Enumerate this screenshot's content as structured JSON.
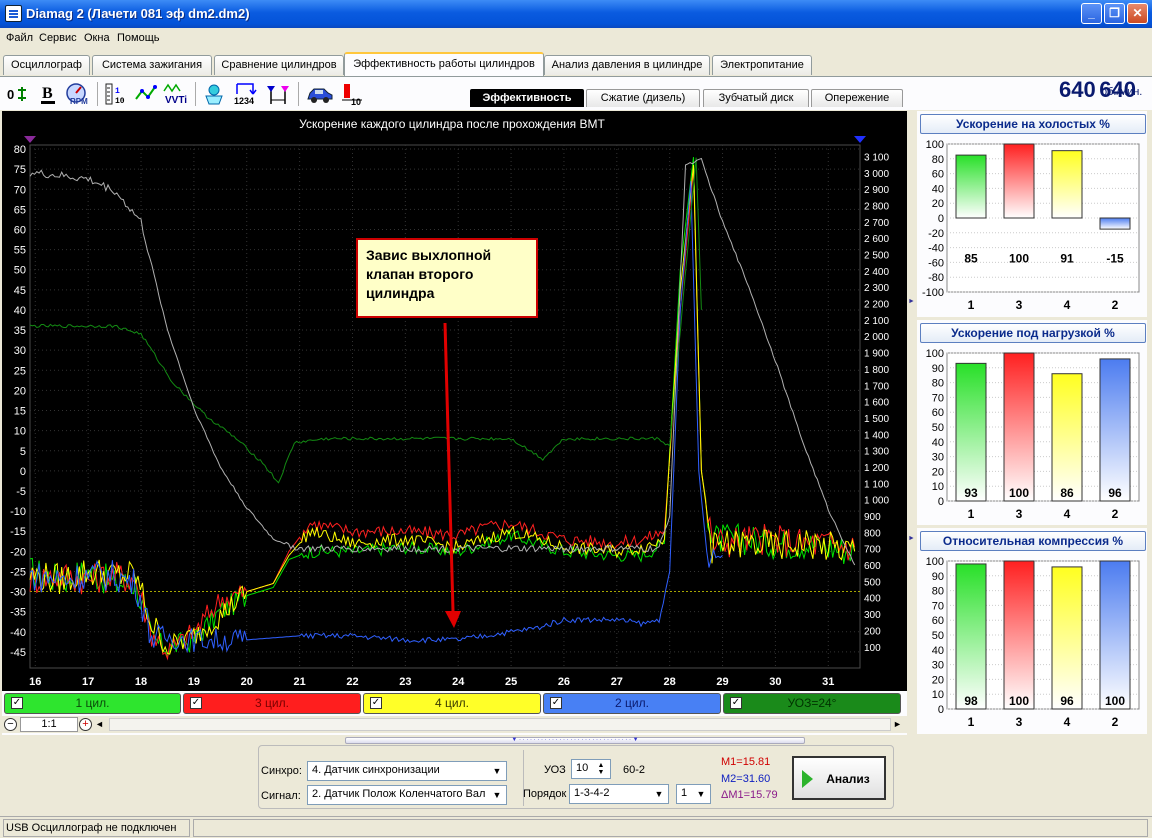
{
  "window": {
    "title": "Diamag 2 (Лачети 081 эф dm2.dm2)"
  },
  "menu": [
    "Файл",
    "Сервис",
    "Окна",
    "Помощь"
  ],
  "tabs": [
    "Осциллограф",
    "Система зажигания",
    "Сравнение цилиндров",
    "Эффективность работы цилиндров",
    "Анализ давления в цилиндре",
    "Электропитание"
  ],
  "active_tab": 3,
  "toolbar": {
    "icons": [
      "zero-icon",
      "bold-b-icon",
      "rpm-icon",
      "ruler-icon",
      "points-icon",
      "vvti-icon",
      "cylinder-icon",
      "numbers-1234-icon",
      "marker-icon",
      "car-icon",
      "bar-10-icon"
    ]
  },
  "subtabs": [
    "Эффективность",
    "Сжатие (дизель)",
    "Зубчатый диск",
    "Опережение"
  ],
  "active_subtab": 0,
  "rpm": {
    "value": "640",
    "unit": "об./мин."
  },
  "chart_data": {
    "type": "line",
    "title": "Ускорение каждого цилиндра после прохождения ВМТ",
    "x_ticks": [
      "16",
      "17",
      "18",
      "19",
      "20",
      "21",
      "22",
      "23",
      "24",
      "25",
      "26",
      "27",
      "28",
      "29",
      "30",
      "31"
    ],
    "y_left_ticks": [
      "80",
      "75",
      "70",
      "65",
      "60",
      "55",
      "50",
      "45",
      "40",
      "35",
      "30",
      "25",
      "20",
      "15",
      "10",
      "5",
      "0",
      "-5",
      "-10",
      "-15",
      "-20",
      "-25",
      "-30",
      "-35",
      "-40",
      "-45"
    ],
    "y_right_ticks": [
      "3 100",
      "3 000",
      "2 900",
      "2 800",
      "2 700",
      "2 600",
      "2 500",
      "2 400",
      "2 300",
      "2 200",
      "2 100",
      "2 000",
      "1 900",
      "1 800",
      "1 700",
      "1 600",
      "1 500",
      "1 400",
      "1 300",
      "1 200",
      "1 100",
      "1 000",
      "900",
      "800",
      "700",
      "600",
      "500",
      "400",
      "300",
      "200",
      "100"
    ],
    "xlim": [
      15.9,
      31.6
    ],
    "ylim_left": [
      -49,
      81
    ],
    "ylim_right": [
      -30,
      3170
    ],
    "reference_line": -30,
    "series": [
      {
        "name": "1 цил.",
        "color": "#00E000",
        "axis": "left",
        "x": [
          15.9,
          16.5,
          17,
          17.5,
          17.9,
          18.2,
          18.5,
          19,
          19.5,
          20,
          20.5,
          20.8,
          21.2,
          22,
          23,
          24,
          24.5,
          25,
          26,
          27,
          27.5,
          27.9,
          28.2,
          28.45,
          28.6,
          28.8,
          29.5,
          30,
          30.5,
          31,
          31.5
        ],
        "y": [
          -25,
          -27,
          -25,
          -28,
          -28,
          -42,
          -44,
          -42,
          -35,
          -31,
          -29,
          -22,
          -20,
          -20,
          -19,
          -20,
          -18,
          -16,
          -20,
          -21,
          -21,
          -18,
          50,
          78,
          0,
          -17,
          -17,
          -18,
          -18,
          -19,
          -20
        ]
      },
      {
        "name": "3 цил.",
        "color": "#FF2020",
        "axis": "left",
        "x": [
          15.9,
          16.5,
          17,
          17.5,
          17.9,
          18.2,
          18.5,
          19,
          19.5,
          20,
          20.5,
          20.8,
          21.2,
          22,
          23,
          24,
          24.5,
          25,
          26,
          27,
          27.5,
          27.9,
          28.2,
          28.45,
          28.6,
          28.8,
          29.5,
          30,
          30.5,
          31,
          31.5
        ],
        "y": [
          -27,
          -26,
          -27,
          -26,
          -27,
          -40,
          -45,
          -40,
          -32,
          -30,
          -28,
          -20,
          -13,
          -15,
          -15,
          -16,
          -14,
          -13,
          -17,
          -18,
          -17,
          -15,
          40,
          75,
          0,
          -18,
          -17,
          -17,
          -18,
          -18,
          -19
        ]
      },
      {
        "name": "4 цил.",
        "color": "#FFFF00",
        "axis": "left",
        "x": [
          15.9,
          16.5,
          17,
          17.5,
          17.9,
          18.2,
          18.5,
          19,
          19.5,
          20,
          20.5,
          20.8,
          21.2,
          22,
          23,
          24,
          24.5,
          25,
          26,
          27,
          27.5,
          27.9,
          28.2,
          28.45,
          28.6,
          28.8,
          29.5,
          30,
          30.5,
          31,
          31.5
        ],
        "y": [
          -26,
          -27,
          -25,
          -26,
          -26,
          -38,
          -44,
          -41,
          -36,
          -30,
          -28,
          -21,
          -15,
          -18,
          -17,
          -19,
          -17,
          -15,
          -19,
          -20,
          -19,
          -17,
          45,
          76,
          0,
          -19,
          -18,
          -19,
          -18,
          -19,
          -20
        ]
      },
      {
        "name": "2 цил.",
        "color": "#3060FF",
        "axis": "left",
        "x": [
          15.9,
          16.5,
          17,
          17.5,
          17.9,
          18.2,
          19,
          20,
          21,
          22,
          23,
          24,
          24.5,
          25,
          25.5,
          26,
          27,
          27.5,
          27.8,
          28,
          28.2,
          28.4,
          28.55,
          28.7,
          29
        ],
        "y": [
          -26,
          -27,
          -26,
          -26,
          -28,
          -41,
          -42,
          -42,
          -41,
          -41,
          -42,
          -42,
          -41,
          -40,
          -39,
          -37,
          -37,
          -38,
          -37,
          -25,
          40,
          72,
          0,
          -20,
          -21
        ]
      },
      {
        "name": "УОЗ=24°",
        "color": "#138A13",
        "axis": "left",
        "x": [
          15.9,
          16.5,
          17.5,
          18,
          18.6,
          19.2,
          19.8,
          20.3,
          20.6,
          20.9,
          21.5,
          22,
          23,
          24,
          25,
          25.6,
          26,
          27,
          27.8,
          28,
          28.5,
          28.6
        ],
        "y": [
          36,
          36,
          36,
          34,
          22,
          14,
          8,
          2,
          -3,
          7,
          8,
          8,
          8,
          8,
          8,
          3,
          8,
          8,
          8,
          6,
          78,
          40
        ]
      },
      {
        "name": "RPM",
        "color": "#B0B0B0",
        "axis": "right",
        "x": [
          15.9,
          16.5,
          17,
          17.5,
          18,
          18.5,
          19,
          19.5,
          20,
          20.5,
          21,
          21.5,
          22,
          23,
          24,
          25,
          26,
          27,
          27.8,
          28,
          28.3,
          28.6,
          29,
          29.5,
          30,
          30.5,
          31,
          31.5
        ],
        "y": [
          3000,
          2980,
          2960,
          2890,
          2700,
          2040,
          1560,
          1200,
          950,
          760,
          700,
          700,
          700,
          700,
          700,
          700,
          700,
          700,
          700,
          900,
          3050,
          3080,
          2700,
          2300,
          1850,
          1370,
          940,
          600
        ]
      }
    ]
  },
  "callout": {
    "text": "Завис выхлопной клапан второго цилиндра"
  },
  "legend": [
    {
      "label": "1 цил.",
      "bg": "#2EE52E",
      "color": "#0A4A0A"
    },
    {
      "label": "3 цил.",
      "bg": "#FF1E1E",
      "color": "#7A0000"
    },
    {
      "label": "4 цил.",
      "bg": "#FFFF28",
      "color": "#3A3A00"
    },
    {
      "label": "2 цил.",
      "bg": "#4880F4",
      "color": "#0A1A6E"
    },
    {
      "label": "УОЗ=24°",
      "bg": "#1A8A1A",
      "color": "#003300"
    }
  ],
  "scroll": {
    "zoom": "1:1"
  },
  "bottom": {
    "sync_label": "Синхро:",
    "sync_value": "4.  Датчик синхронизации",
    "signal_label": "Сигнал:",
    "signal_value": "2.  Датчик Полож Коленчатого Вал",
    "uoz_label": "УОЗ",
    "uoz_value": "10",
    "wheel": "60-2",
    "order_label": "Порядок",
    "order_value": "1-3-4-2",
    "order_num": "1",
    "m1": "M1=15.81",
    "m2": "M2=31.60",
    "dm1": "ΔM1=15.79",
    "analyze": "Анализ"
  },
  "bar_charts": [
    {
      "title": "Ускорение на холостых %",
      "ylim": [
        -100,
        100
      ],
      "ticks": [
        "100",
        "80",
        "60",
        "40",
        "20",
        "0",
        "-20",
        "-40",
        "-60",
        "-80",
        "-100"
      ],
      "categories": [
        "1",
        "3",
        "4",
        "2"
      ],
      "values": [
        85,
        100,
        91,
        -15
      ],
      "labels": [
        "85",
        "100",
        "91",
        "-15"
      ],
      "colors": [
        "#28E028",
        "#FF2020",
        "#FFFF20",
        "#4C7CF0"
      ]
    },
    {
      "title": "Ускорение под нагрузкой %",
      "ylim": [
        0,
        100
      ],
      "ticks": [
        "100",
        "90",
        "80",
        "70",
        "60",
        "50",
        "40",
        "30",
        "20",
        "10",
        "0"
      ],
      "categories": [
        "1",
        "3",
        "4",
        "2"
      ],
      "values": [
        93,
        100,
        86,
        96
      ],
      "labels": [
        "93",
        "100",
        "86",
        "96"
      ],
      "colors": [
        "#28E028",
        "#FF2020",
        "#FFFF20",
        "#4C7CF0"
      ]
    },
    {
      "title": "Относительная компрессия %",
      "ylim": [
        0,
        100
      ],
      "ticks": [
        "100",
        "90",
        "80",
        "70",
        "60",
        "50",
        "40",
        "30",
        "20",
        "10",
        "0"
      ],
      "categories": [
        "1",
        "3",
        "4",
        "2"
      ],
      "values": [
        98,
        100,
        96,
        100
      ],
      "labels": [
        "98",
        "100",
        "96",
        "100"
      ],
      "colors": [
        "#28E028",
        "#FF2020",
        "#FFFF20",
        "#4C7CF0"
      ]
    }
  ],
  "status": {
    "text": "USB Осциллограф не подключен"
  }
}
